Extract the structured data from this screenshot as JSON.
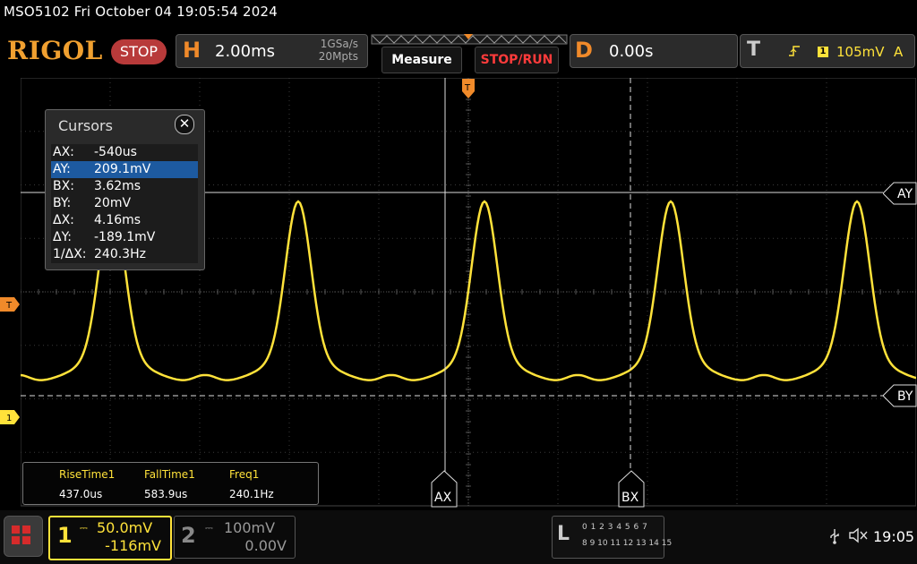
{
  "status_line": "MSO5102  Fri October 04 19:05:54 2024",
  "header": {
    "logo": "RIGOL",
    "run_state": "STOP",
    "horizontal": {
      "letter": "H",
      "timebase": "2.00ms",
      "sample_rate": "1GSa/s",
      "memory_depth": "20Mpts"
    },
    "measure_button": "Measure",
    "stoprun_button": "STOP/RUN",
    "delay": {
      "letter": "D",
      "value": "0.00s"
    },
    "trigger": {
      "letter": "T",
      "slope_icon": "rising-edge-icon",
      "source": "1",
      "level": "105mV",
      "mode": "A"
    }
  },
  "cursor_panel": {
    "title": "Cursors",
    "close_icon": "close-icon",
    "rows": [
      {
        "label": "AX:",
        "value": "-540us",
        "selected": false
      },
      {
        "label": "AY:",
        "value": "209.1mV",
        "selected": true
      },
      {
        "label": "BX:",
        "value": "3.62ms",
        "selected": false
      },
      {
        "label": "BY:",
        "value": "20mV",
        "selected": false
      },
      {
        "label": "ΔX:",
        "value": "4.16ms",
        "selected": false
      },
      {
        "label": "ΔY:",
        "value": "-189.1mV",
        "selected": false
      },
      {
        "label": "1/ΔX:",
        "value": "240.3Hz",
        "selected": false
      }
    ]
  },
  "cursor_labels": {
    "ax": "AX",
    "bx": "BX",
    "ay": "AY",
    "by": "BY"
  },
  "markers": {
    "trigger_level": "T",
    "ch1_ground": "1",
    "trigger_position": "T"
  },
  "measurements": [
    {
      "label": "RiseTime1",
      "value": "437.0us"
    },
    {
      "label": "FallTime1",
      "value": "583.9us"
    },
    {
      "label": "Freq1",
      "value": "240.1Hz"
    }
  ],
  "channels": {
    "ch1": {
      "number": "1",
      "scale": "50.0mV",
      "offset": "-116mV",
      "color": "#ffe23a"
    },
    "ch2": {
      "number": "2",
      "scale": "100mV",
      "offset": "0.00V",
      "color": "#888888"
    }
  },
  "logic_analyzer": {
    "letter": "L",
    "row1": "0 1 2 3  4 5 6 7",
    "row2": "8 9 10 11 12 13 14 15"
  },
  "system": {
    "usb_icon": "usb-icon",
    "speaker_icon": "speaker-muted-icon",
    "time": "19:05"
  },
  "colors": {
    "trace": "#ffe23a",
    "accent_orange": "#f08a2a",
    "stop_red": "#ff3b3b",
    "selection_blue": "#1d5aa0"
  }
}
